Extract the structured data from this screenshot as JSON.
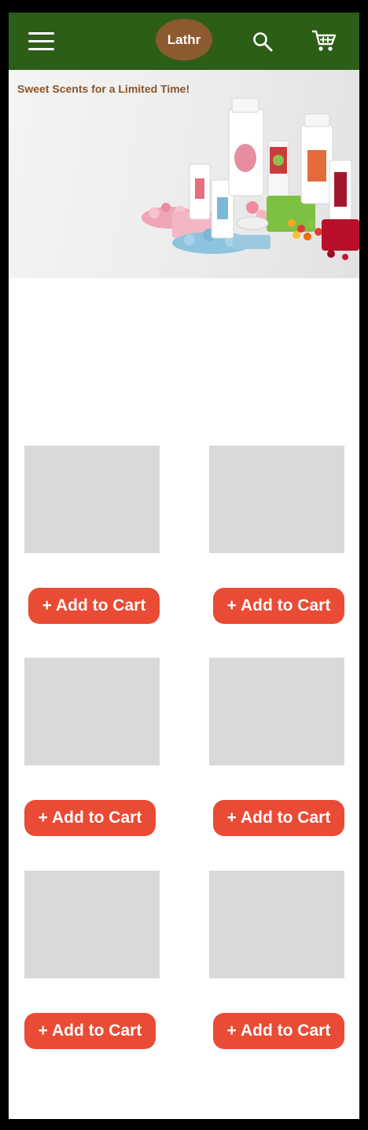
{
  "header": {
    "brand": "Lathr",
    "icons": {
      "menu": "hamburger-menu-icon",
      "search": "search-icon",
      "cart": "shopping-cart-icon"
    },
    "bg_color": "#2d5e17",
    "logo_color": "#8c5a2f"
  },
  "hero": {
    "headline": "Sweet Scents for a Limited Time!",
    "headline_color": "#8a5428"
  },
  "products": [
    {
      "button_label": "+ Add to Cart"
    },
    {
      "button_label": "+ Add to Cart"
    },
    {
      "button_label": "+ Add to Cart"
    },
    {
      "button_label": "+ Add to Cart"
    },
    {
      "button_label": "+ Add to Cart"
    },
    {
      "button_label": "+ Add to Cart"
    }
  ],
  "colors": {
    "button": "#e94b35",
    "placeholder": "#d9d9d9"
  }
}
